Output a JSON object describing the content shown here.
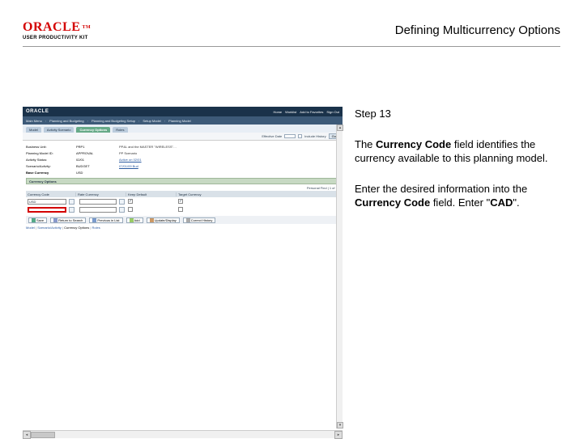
{
  "header": {
    "logo_text": "ORACLE",
    "logo_sub": "USER PRODUCTIVITY KIT",
    "page_title": "Defining Multicurrency Options"
  },
  "instructions": {
    "step_label": "Step 13",
    "p1_a": "The ",
    "p1_b": "Currency Code",
    "p1_c": " field identifies the currency available to this planning model.",
    "p2_a": "Enter the desired information into the ",
    "p2_b": "Currency Code",
    "p2_c": " field. Enter \"",
    "p2_d": "CAD",
    "p2_e": "\"."
  },
  "ui": {
    "top_brand": "ORACLE",
    "top_links": [
      "Home",
      "Worklist",
      "Add to Favorites",
      "Sign Out"
    ],
    "nav": [
      "Main Menu",
      "Planning and Budgeting",
      "Planning and Budgeting Setup",
      "Setup Model",
      "Planning Model"
    ],
    "tabs": {
      "t1": "Model",
      "t2": "Activity Scenario",
      "t3": "Currency Options",
      "t4": "Roles"
    },
    "filter": {
      "eff_label": "Effective Date",
      "hist_label": "Include History",
      "go": "Go"
    },
    "form": {
      "r1l": "Business Unit:",
      "r1v1": "PRP1",
      "r1desc": "PP&L and the MASTER \"WIRELESS\"…",
      "r2l": "Planning Model ID:",
      "r2v1": "APPROVAL",
      "r2desc": "PP Scenario",
      "r3l": "Activity Status:",
      "r3v1": "02/01",
      "r3link": "Active on 02/01",
      "r4l": "Scenario/Activity:",
      "r4v1": "BUDGET",
      "r4link": "07/01/09 Bud",
      "r5l": "Base Currency",
      "r5v1": "USD"
    },
    "section_title": "Currency Options",
    "grid": {
      "cols": [
        "Currency Code",
        "Rate Currency",
        "Keep Default",
        "Target Currency"
      ],
      "row1_val": "USD",
      "grid_meta": "Personal Find |  1 of 1  | "
    },
    "actions": {
      "save": "Save",
      "return": "Return to Search",
      "prev": "Previous in List",
      "add": "Add",
      "update": "Update/Display",
      "correct": "Correct History"
    },
    "breadcrumbs": {
      "a": "Model",
      "b": "Scenario/Activity",
      "c": "Currency Options",
      "d": "Roles"
    }
  }
}
